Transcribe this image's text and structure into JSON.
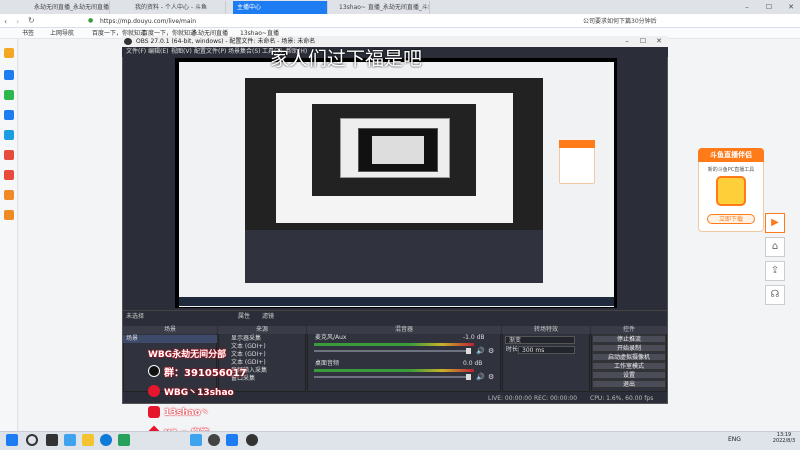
{
  "browser": {
    "tabs": [
      {
        "label": "永劫无间直播_永劫无间直播解说视频",
        "active": false
      },
      {
        "label": "我的资料 - 个人中心 - 斗鱼",
        "active": false
      },
      {
        "label": "主播中心",
        "active": true
      },
      {
        "label": "13shao~ 直播_永劫无间直播_斗鱼直",
        "active": false
      }
    ],
    "url": "https://mp.douyu.com/live/main",
    "search_hint": "公司要求如何下篇30分钟后",
    "bookmarks": [
      "书签",
      "上网导航",
      "百度一下，你就知道",
      "百度一下，你就知道",
      "永劫无间直播",
      "13shao~直播"
    ]
  },
  "page": {
    "overlay_text": "家人们过下福是吧"
  },
  "obs": {
    "title": "OBS 27.0.1 (64-bit, windows) - 配置文件: 未命名 - 场景: 未命名",
    "menu": [
      "文件(F)",
      "编辑(E)",
      "视图(V)",
      "配置文件(P)",
      "场景集合(S)",
      "工具(T)",
      "帮助(H)"
    ],
    "status_strip": {
      "label": "未选择",
      "props": "属性",
      "filters": "滤镜"
    },
    "panels": {
      "scenes_header": "场景",
      "scene_item": "场景",
      "sources_header": "来源",
      "sources": [
        "显示器采集",
        "文本 (GDI+)",
        "文本 (GDI+)",
        "文本 (GDI+)",
        "音频输入采集",
        "窗口采集"
      ],
      "mixer_header": "混音器",
      "mixer_tracks": [
        {
          "name": "麦克风/Aux",
          "db": "-1.0 dB"
        },
        {
          "name": "桌面音频",
          "db": "0.0 dB"
        }
      ],
      "transitions_header": "转场特效",
      "transition_type": "渐变",
      "duration_label": "时长",
      "duration_value": "300 ms",
      "controls_header": "控件",
      "controls": [
        "停止推流",
        "开始录制",
        "启动虚拟摄像机",
        "工作室模式",
        "设置",
        "退出"
      ]
    },
    "statusbar": {
      "live": "LIVE: 00:00:00",
      "rec": "REC: 00:00:00",
      "cpu": "CPU: 1.6%, 60.00 fps"
    }
  },
  "overlays": {
    "wbg": "WBG永劫无间分部",
    "qq": "群：391056017",
    "weibo": "WBG丶13shao",
    "name": "13shao丶",
    "room": "X2 = 房管"
  },
  "promo": {
    "title": "斗鱼直播伴侣",
    "desc": "新的斗鱼PC直播工具",
    "button": "立即下载"
  },
  "taskbar": {
    "lang": "ENG",
    "time": "13:19",
    "date": "2022/8/3"
  }
}
